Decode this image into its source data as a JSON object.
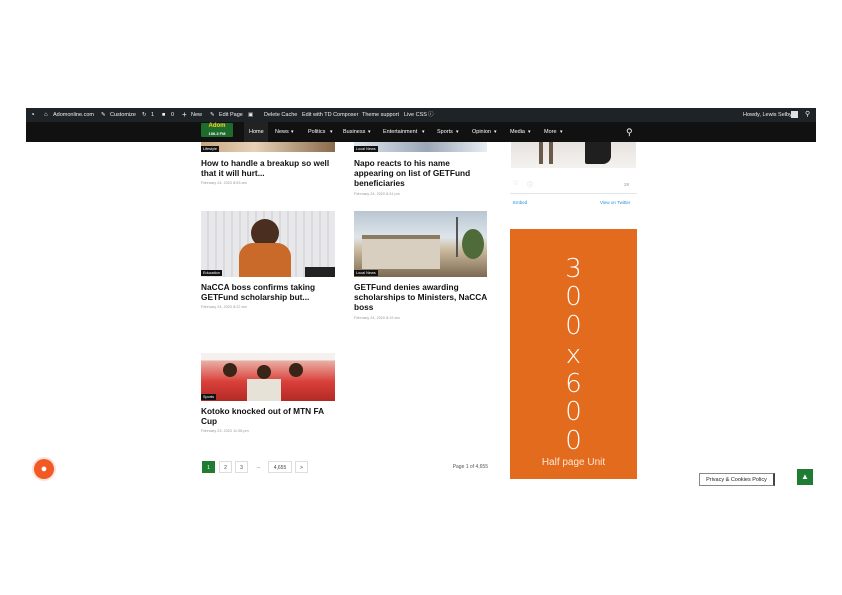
{
  "admin_bar": {
    "site_name": "Adomonline.com",
    "customize": "Customize",
    "revisions_count": "1",
    "comments_count": "0",
    "new_label": "New",
    "edit_page": "Edit Page",
    "delete_cache": "Delete Cache",
    "edit_composer": "Edit with TD Composer",
    "theme_support": "Theme support",
    "live_css": "Live CSS",
    "greeting": "Howdy, Lewis Selby"
  },
  "nav": {
    "logo_top": "Adom",
    "logo_bottom": "106.3 FM",
    "items": [
      "Home",
      "News",
      "Politics",
      "Business",
      "Entertainment",
      "Sports",
      "Opinion",
      "Media",
      "More"
    ]
  },
  "articles": [
    {
      "category": "Lifestyle",
      "title": "How to handle a breakup so well that it will hurt...",
      "date": "February 24, 2020 8:53 am"
    },
    {
      "category": "Local News",
      "title": "Napo reacts to his name appearing on list of GETFund beneficiaries",
      "date": "February 24, 2020 8:31 pm"
    },
    {
      "category": "Education",
      "title": "NaCCA boss confirms taking GETFund scholarship but...",
      "date": "February 24, 2020 8:22 am"
    },
    {
      "category": "Local News",
      "title": "GETFund denies awarding scholarships to Ministers, NaCCA boss",
      "date": "February 24, 2020 8:19 am"
    },
    {
      "category": "Sports",
      "title": "Kotoko knocked out of MTN FA Cup",
      "date": "February 23, 2020 11:08 pm"
    }
  ],
  "pagination": {
    "pages": [
      "1",
      "2",
      "3",
      "...",
      "4,655",
      ">"
    ],
    "summary": "Page 1 of 4,655"
  },
  "twitter_embed": {
    "like_count": "28",
    "embed_label": "Embed",
    "view_label": "View on Twitter"
  },
  "ad": {
    "chars": [
      "3",
      "0",
      "0",
      "x",
      "6",
      "0",
      "0"
    ],
    "caption": "Half page Unit",
    "color": "#e36b1d"
  },
  "privacy_label": "Privacy & Cookies Policy",
  "colors": {
    "accent": "#1e7d33",
    "admin_bar": "#1d2327",
    "nav_bar": "#111111"
  }
}
